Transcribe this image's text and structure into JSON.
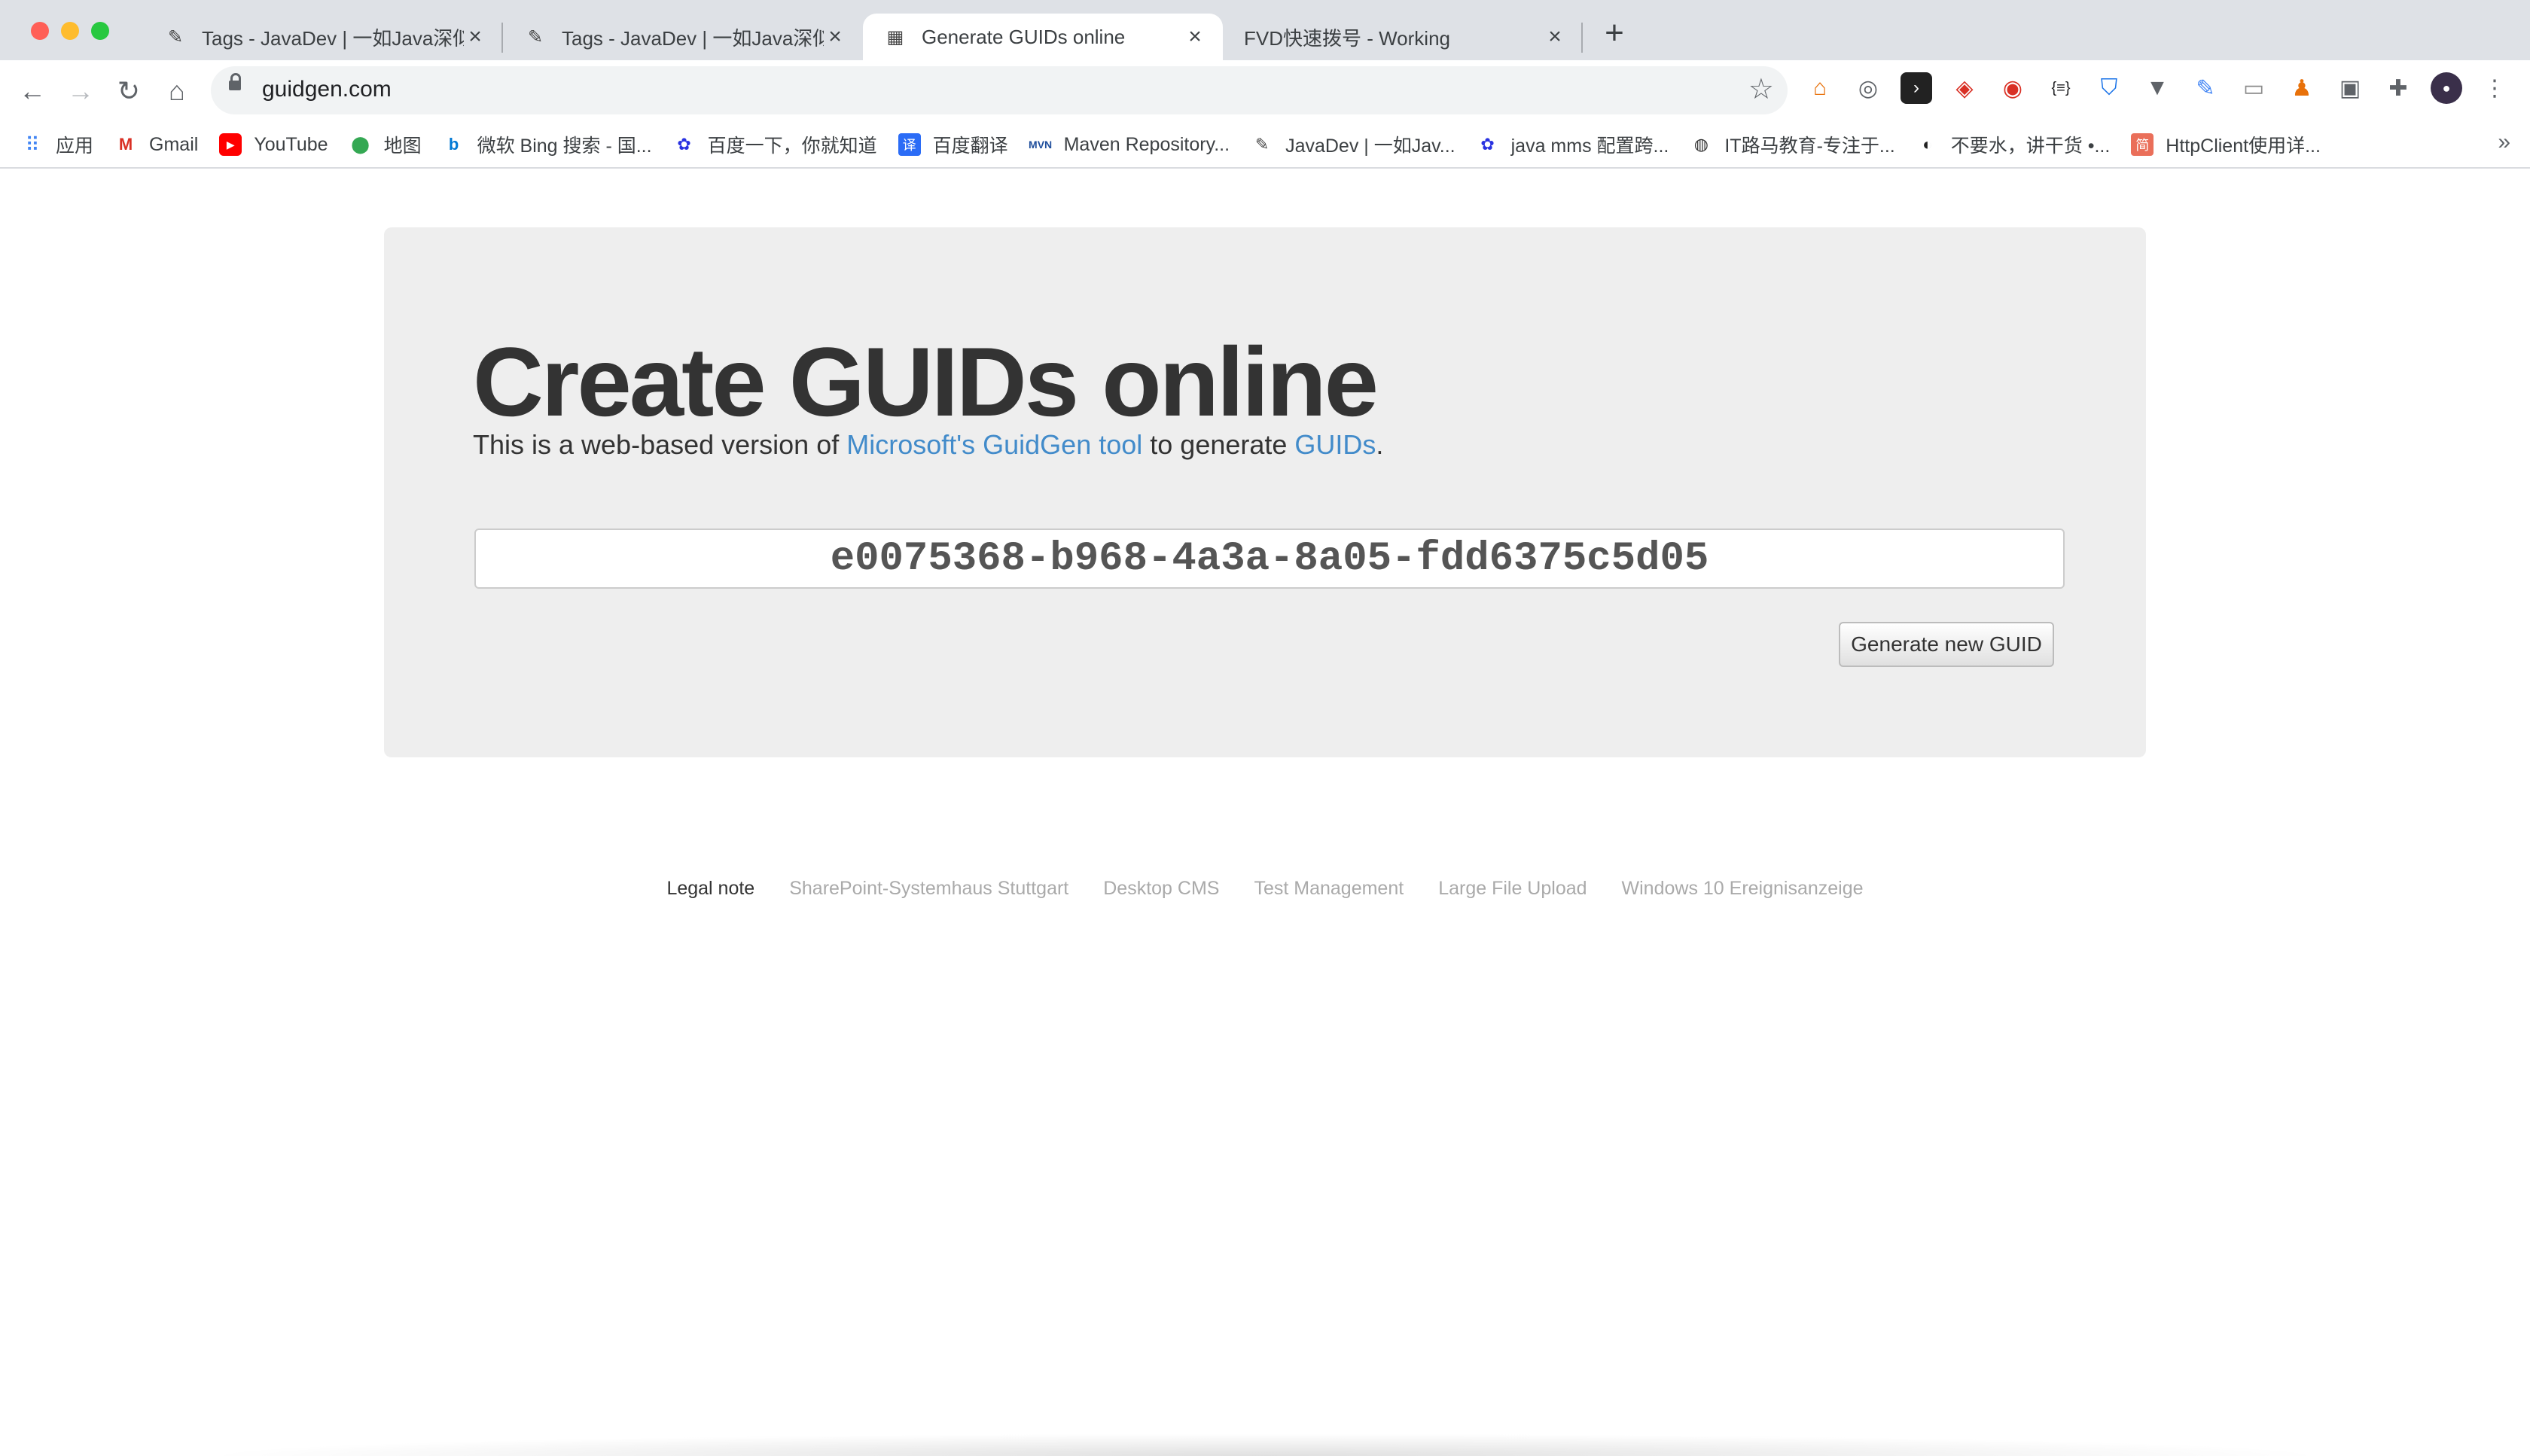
{
  "browser": {
    "tabs": [
      {
        "title": "Tags - JavaDev | 一如Java深似海",
        "favicon": "javadev-favicon",
        "active": false
      },
      {
        "title": "Tags - JavaDev | 一如Java深似海",
        "favicon": "javadev-favicon",
        "active": false
      },
      {
        "title": "Generate GUIDs online",
        "favicon": "calculator-favicon",
        "active": true
      },
      {
        "title": "FVD快速拨号 - Working",
        "favicon": "",
        "active": false
      }
    ],
    "new_tab_label": "+",
    "url": "guidgen.com",
    "bookmarks": [
      {
        "label": "应用",
        "icon": "apps-grid-icon"
      },
      {
        "label": "Gmail",
        "icon": "gmail-icon"
      },
      {
        "label": "YouTube",
        "icon": "youtube-icon"
      },
      {
        "label": "地图",
        "icon": "maps-pin-icon"
      },
      {
        "label": "微软 Bing 搜索 - 国...",
        "icon": "bing-icon"
      },
      {
        "label": "百度一下，你就知道",
        "icon": "baidu-icon"
      },
      {
        "label": "百度翻译",
        "icon": "baidu-translate-icon"
      },
      {
        "label": "Maven Repository...",
        "icon": "maven-icon"
      },
      {
        "label": "JavaDev | 一如Jav...",
        "icon": "javadev-icon"
      },
      {
        "label": "java mms 配置跨...",
        "icon": "baidu-paw-icon"
      },
      {
        "label": "IT路马教育-专注于...",
        "icon": "globe-icon"
      },
      {
        "label": "不要水，讲干货 •...",
        "icon": "github-style-icon"
      },
      {
        "label": "HttpClient使用详...",
        "icon": "jianshu-icon"
      }
    ],
    "bookmarks_more": "»"
  },
  "page": {
    "heading": "Create GUIDs online",
    "lead_prefix": "This is a web-based version of ",
    "lead_link1": "Microsoft's GuidGen tool",
    "lead_middle": " to generate ",
    "lead_link2": "GUIDs",
    "lead_suffix": ".",
    "guid_value": "e0075368-b968-4a3a-8a05-fdd6375c5d05",
    "generate_button": "Generate new GUID",
    "footer_links": [
      {
        "label": "Legal note",
        "style": "dark"
      },
      {
        "label": "SharePoint-Systemhaus Stuttgart",
        "style": "muted"
      },
      {
        "label": "Desktop CMS",
        "style": "muted"
      },
      {
        "label": "Test Management",
        "style": "muted"
      },
      {
        "label": "Large File Upload",
        "style": "muted"
      },
      {
        "label": "Windows 10 Ereignisanzeige",
        "style": "muted"
      }
    ]
  },
  "colors": {
    "link": "#428bca",
    "jumbotron_bg": "#eeeeee",
    "heading": "#333333",
    "footer_muted": "#aaaaaa"
  }
}
